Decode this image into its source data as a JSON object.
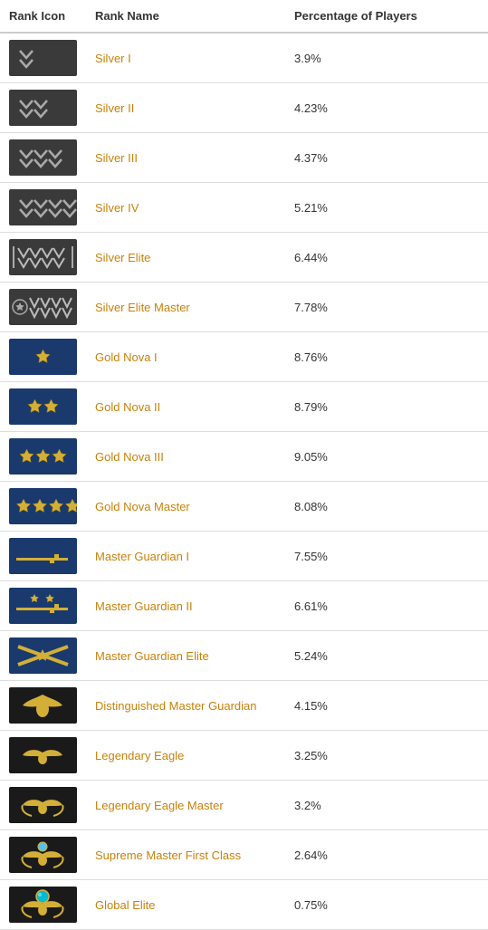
{
  "header": {
    "col1": "Rank Icon",
    "col2": "Rank Name",
    "col3": "Percentage of Players"
  },
  "ranks": [
    {
      "id": "silver-i",
      "name": "Silver I",
      "percentage": "3.9%",
      "tier": "silver",
      "stars": 1
    },
    {
      "id": "silver-ii",
      "name": "Silver II",
      "percentage": "4.23%",
      "tier": "silver",
      "stars": 2
    },
    {
      "id": "silver-iii",
      "name": "Silver III",
      "percentage": "4.37%",
      "tier": "silver",
      "stars": 3
    },
    {
      "id": "silver-iv",
      "name": "Silver IV",
      "percentage": "5.21%",
      "tier": "silver",
      "stars": 4
    },
    {
      "id": "silver-elite",
      "name": "Silver Elite",
      "percentage": "6.44%",
      "tier": "silver-elite",
      "stars": 0
    },
    {
      "id": "silver-elite-master",
      "name": "Silver Elite Master",
      "percentage": "7.78%",
      "tier": "silver-elite-master",
      "stars": 0
    },
    {
      "id": "gold-nova-i",
      "name": "Gold Nova I",
      "percentage": "8.76%",
      "tier": "gold",
      "stars": 1
    },
    {
      "id": "gold-nova-ii",
      "name": "Gold Nova II",
      "percentage": "8.79%",
      "tier": "gold",
      "stars": 2
    },
    {
      "id": "gold-nova-iii",
      "name": "Gold Nova III",
      "percentage": "9.05%",
      "tier": "gold",
      "stars": 3
    },
    {
      "id": "gold-nova-master",
      "name": "Gold Nova Master",
      "percentage": "8.08%",
      "tier": "gold-master",
      "stars": 4
    },
    {
      "id": "master-guardian-i",
      "name": "Master Guardian I",
      "percentage": "7.55%",
      "tier": "mg",
      "stars": 1
    },
    {
      "id": "master-guardian-ii",
      "name": "Master Guardian II",
      "percentage": "6.61%",
      "tier": "mg",
      "stars": 2
    },
    {
      "id": "master-guardian-elite",
      "name": "Master Guardian Elite",
      "percentage": "5.24%",
      "tier": "mge",
      "stars": 0
    },
    {
      "id": "distinguished-master-guardian",
      "name": "Distinguished Master Guardian",
      "percentage": "4.15%",
      "tier": "dmg",
      "stars": 0
    },
    {
      "id": "legendary-eagle",
      "name": "Legendary Eagle",
      "percentage": "3.25%",
      "tier": "le",
      "stars": 0
    },
    {
      "id": "legendary-eagle-master",
      "name": "Legendary Eagle Master",
      "percentage": "3.2%",
      "tier": "lem",
      "stars": 0
    },
    {
      "id": "supreme-master-first-class",
      "name": "Supreme Master First Class",
      "percentage": "2.64%",
      "tier": "smfc",
      "stars": 0
    },
    {
      "id": "global-elite",
      "name": "Global Elite",
      "percentage": "0.75%",
      "tier": "ge",
      "stars": 0
    }
  ]
}
